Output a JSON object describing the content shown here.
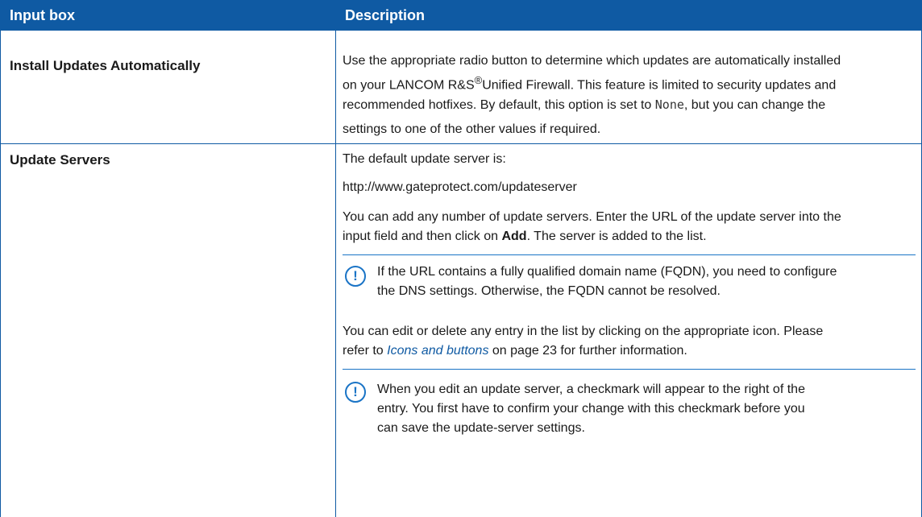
{
  "header": {
    "col1": "Input box",
    "col2": "Description"
  },
  "rows": [
    {
      "label": "Install Updates Automatically",
      "text_lines": {
        "l1": "Use the appropriate radio button to determine which updates are automatically installed",
        "l2a": "on your LANCOM R&S",
        "l2sup": "®",
        "l2b": "Unified Firewall. This feature is limited to security updates and",
        "l3a": "recommended hotfixes. By default, this option is set to ",
        "l3code": "None",
        "l3b": ", but you can change the",
        "l4": "settings to one of the other values if required."
      }
    },
    {
      "label": "Update Servers",
      "default_intro": "The default update server is:",
      "default_url": "http://www.gateprotect.com/updateserver",
      "add_a": "You can add any number of update servers. Enter the URL of the update server into the",
      "add_b1": "input field and then click on ",
      "add_bold": "Add",
      "add_b2": ". The server is added to the list.",
      "note1_l1": "If the URL contains a fully qualified domain name (FQDN), you need to configure",
      "note1_l2": "the DNS settings. Otherwise, the FQDN cannot be resolved.",
      "edit_l1": "You can edit or delete any entry in the list by clicking on the appropriate icon. Please",
      "edit_l2a": "refer to ",
      "edit_link": "Icons and buttons",
      "edit_l2b": " on page 23 for further information.",
      "note2_l1": "When you edit an update server, a checkmark will appear to the right of the",
      "note2_l2": "entry. You first have to confirm your change with this checkmark before you",
      "note2_l3": "can save the update-server settings."
    }
  ],
  "icons": {
    "note_icon_glyph": "!"
  },
  "colors": {
    "header_bg": "#0f5aa3",
    "accent": "#1a74c6"
  }
}
